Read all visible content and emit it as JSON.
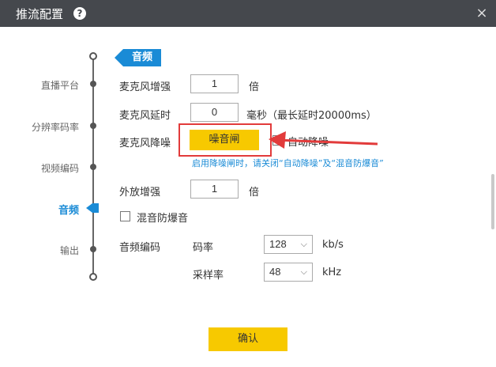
{
  "window": {
    "title": "推流配置",
    "help_icon": "?",
    "close_icon": "×"
  },
  "nav": {
    "items": [
      {
        "label": "直播平台",
        "active": false
      },
      {
        "label": "分辨率码率",
        "active": false
      },
      {
        "label": "视频编码",
        "active": false
      },
      {
        "label": "音频",
        "active": true
      },
      {
        "label": "输出",
        "active": false
      }
    ]
  },
  "section": {
    "title": "音频"
  },
  "mic_boost": {
    "label": "麦克风增强",
    "value": "1",
    "unit": "倍"
  },
  "mic_delay": {
    "label": "麦克风延时",
    "value": "0",
    "unit": "毫秒（最长延时20000ms）"
  },
  "mic_denoise": {
    "label": "麦克风降噪",
    "button": "噪音闸",
    "auto_label": "自动降噪",
    "auto_checked": false,
    "hint": "启用降噪闸时，请关闭“自动降噪”及“混音防爆音”"
  },
  "speaker_boost": {
    "label": "外放增强",
    "value": "1",
    "unit": "倍"
  },
  "mix_protect": {
    "label": "混音防爆音",
    "checked": false
  },
  "audio_codec": {
    "label": "音频编码",
    "bitrate": {
      "label": "码率",
      "value": "128",
      "unit": "kb/s"
    },
    "samplerate": {
      "label": "采样率",
      "value": "48",
      "unit": "kHz"
    }
  },
  "footer": {
    "confirm": "确认"
  },
  "colors": {
    "accent": "#1a8bd6",
    "button": "#f7c900",
    "titlebar": "#45484d",
    "annotation": "#e23b3b"
  }
}
